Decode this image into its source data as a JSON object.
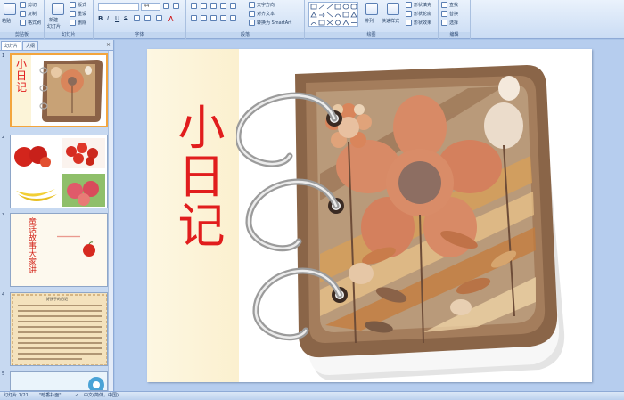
{
  "ribbon": {
    "clipboard": {
      "label": "剪贴板",
      "paste": "粘贴",
      "cut": "剪切",
      "copy": "复制",
      "format_painter": "格式刷"
    },
    "slides": {
      "label": "幻灯片",
      "new_slide": "新建",
      "new_slide_2": "幻灯片",
      "layout": "版式",
      "reset": "重设",
      "delete": "删除"
    },
    "font": {
      "label": "字体",
      "font_size": "44"
    },
    "paragraph": {
      "label": "段落",
      "text_direction": "文字方向",
      "align_text": "对齐文本",
      "convert_smartart": "转换为 SmartArt"
    },
    "drawing": {
      "label": "绘图",
      "arrange": "排列",
      "quick_styles": "快速样式",
      "shape_fill": "形状填充",
      "shape_outline": "形状轮廓",
      "shape_effects": "形状效果"
    },
    "editing": {
      "label": "编辑",
      "find": "查找",
      "replace": "替换",
      "select": "选择"
    }
  },
  "left_panel": {
    "tabs": [
      "幻灯片",
      "大纲"
    ],
    "close": "×",
    "thumbnails": [
      {
        "num": "1",
        "title": "小日记"
      },
      {
        "num": "2"
      },
      {
        "num": "3",
        "title": "童话故事大家讲",
        "caption": "*************"
      },
      {
        "num": "4",
        "caption": "好孩子的日记"
      },
      {
        "num": "5"
      }
    ]
  },
  "slide": {
    "title": "小日记"
  },
  "status": {
    "slide_info": "幻灯片 1/21",
    "theme": "\"暗香扑面\"",
    "language": "中文(简体，中国)"
  },
  "colors": {
    "title_red": "#e11d1d",
    "ribbon_bg": "#dbe8fa",
    "selection_orange": "#f3a53d"
  }
}
